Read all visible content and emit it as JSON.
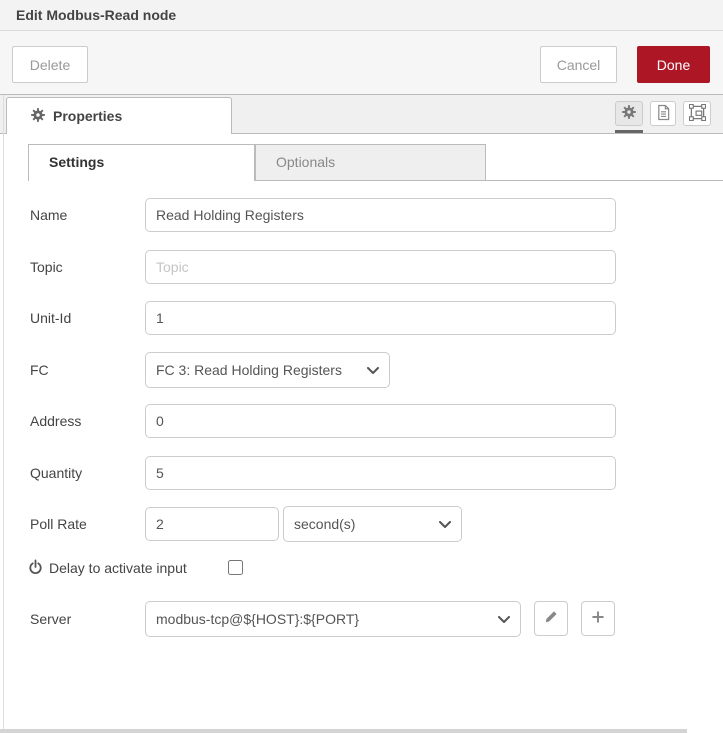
{
  "window": {
    "title": "Edit Modbus-Read node"
  },
  "header_buttons": {
    "delete": "Delete",
    "cancel": "Cancel",
    "done": "Done"
  },
  "properties_bar": {
    "tab_label": "Properties"
  },
  "sub_tabs": {
    "settings": "Settings",
    "optionals": "Optionals"
  },
  "form": {
    "name": {
      "label": "Name",
      "value": "Read Holding Registers"
    },
    "topic": {
      "label": "Topic",
      "placeholder": "Topic"
    },
    "unit_id": {
      "label": "Unit-Id",
      "value": "1"
    },
    "fc": {
      "label": "FC",
      "selected": "FC 3: Read Holding Registers"
    },
    "address": {
      "label": "Address",
      "value": "0"
    },
    "quantity": {
      "label": "Quantity",
      "value": "5"
    },
    "poll_rate": {
      "label": "Poll Rate",
      "value": "2",
      "unit_selected": "second(s)"
    },
    "delay": {
      "label": "Delay to activate input",
      "checked": false
    },
    "server": {
      "label": "Server",
      "selected": "modbus-tcp@${HOST}:${PORT}"
    }
  },
  "icons": {
    "properties_tab": "gear-icon",
    "toolbar": [
      "gear-icon",
      "description-icon",
      "appearance-icon"
    ],
    "server_actions": [
      "pencil-icon",
      "plus-icon"
    ],
    "delay_label": "power-icon",
    "selects": "chevron-down-icon"
  },
  "colors": {
    "primary_button": "#AD1625",
    "header_bg": "#f3f3f3",
    "tab_bar_bg": "#f0f0f0",
    "inactive_tab_bg": "#efefef",
    "border": "#bbbbbb",
    "input_border": "#cccccc"
  }
}
